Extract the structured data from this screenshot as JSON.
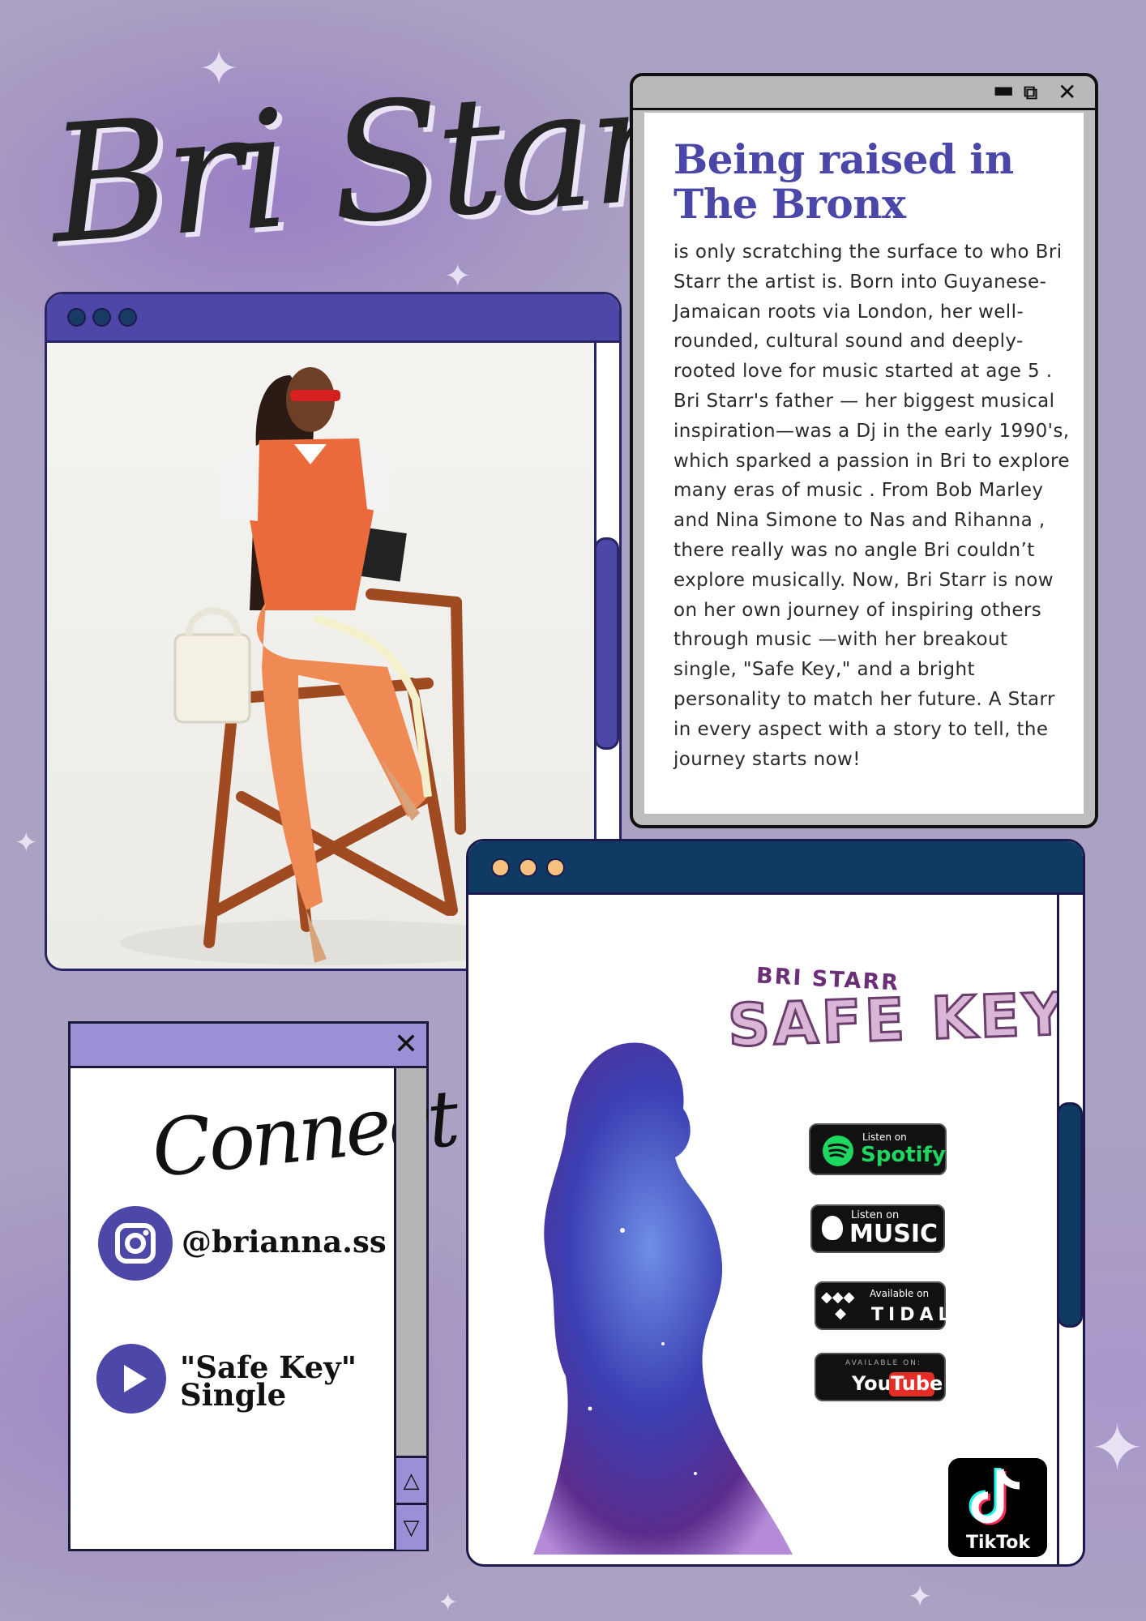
{
  "title": "Bri Starr",
  "bio": {
    "heading_line1": "Being raised in",
    "heading_line2": "The Bronx",
    "text": "is only scratching the surface to who Bri Starr the artist is. Born into Guyanese-Jamaican roots via London, her well-rounded, cultural sound and deeply-rooted love for music started at age 5 . Bri Starr's father — her biggest musical inspiration—was a Dj in the early 1990's, which sparked a passion in Bri to explore many eras of music . From Bob Marley and Nina Simone to Nas and Rihanna , there really was no angle Bri couldn’t explore musically. Now, Bri Starr is now on her own journey of inspiring others through music —with her breakout single, \"Safe Key,\" and a bright personality to match her future. A Starr in every aspect with a story to tell, the journey starts now!"
  },
  "connect": {
    "heading": "Connect",
    "instagram_handle": "@brianna.ss",
    "single_line1": "\"Safe Key\"",
    "single_line2": "Single"
  },
  "music": {
    "artist_logo": "BRI STARR",
    "single_logo": "SAFE KEY",
    "spotify": {
      "small": "Listen on",
      "big": "Spotify"
    },
    "apple": {
      "small": "Listen on",
      "big": "MUSIC"
    },
    "tidal": {
      "small": "Available on",
      "big": "TIDAL"
    },
    "youtube": {
      "small": "AVAILABLE ON:",
      "big_you": "You",
      "big_tube": "Tube"
    },
    "tiktok": "TikTok"
  },
  "icons": {
    "minimize": "minimize-icon",
    "restore": "restore-icon",
    "close": "close-icon",
    "instagram": "instagram-icon",
    "play": "play-icon",
    "scroll_up": "triangle-up-icon",
    "scroll_down": "triangle-down-icon"
  },
  "colors": {
    "background": "#aba1c2",
    "accent_purple": "#4d48a8",
    "navy": "#0f3a63",
    "lavender_bar": "#9b8fd6",
    "dot_yellow": "#f6c27e"
  }
}
